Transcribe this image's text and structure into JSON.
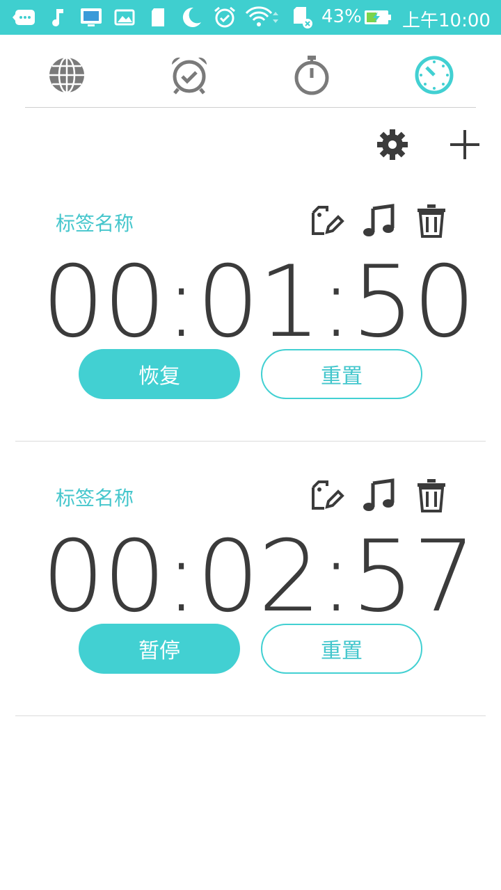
{
  "status_bar": {
    "battery_percent": "43%",
    "time": "上午10:00"
  },
  "tabs": [
    {
      "name": "world-clock",
      "icon": "globe-icon",
      "active": false
    },
    {
      "name": "alarm",
      "icon": "alarm-clock-icon",
      "active": false
    },
    {
      "name": "stopwatch",
      "icon": "stopwatch-icon",
      "active": false
    },
    {
      "name": "timer",
      "icon": "timer-icon",
      "active": true
    }
  ],
  "toolbar": {
    "settings_icon": "gear-icon",
    "add_icon": "plus-icon"
  },
  "timers": [
    {
      "label": "标签名称",
      "time": "00:01:50",
      "primary_button": "恢复",
      "secondary_button": "重置"
    },
    {
      "label": "标签名称",
      "time": "00:02:57",
      "primary_button": "暂停",
      "secondary_button": "重置"
    }
  ],
  "colors": {
    "accent": "#42d0d2",
    "status_bar": "#3fcfcf",
    "text_dark": "#3b3b3b",
    "icon_gray": "#7a7a7a"
  }
}
